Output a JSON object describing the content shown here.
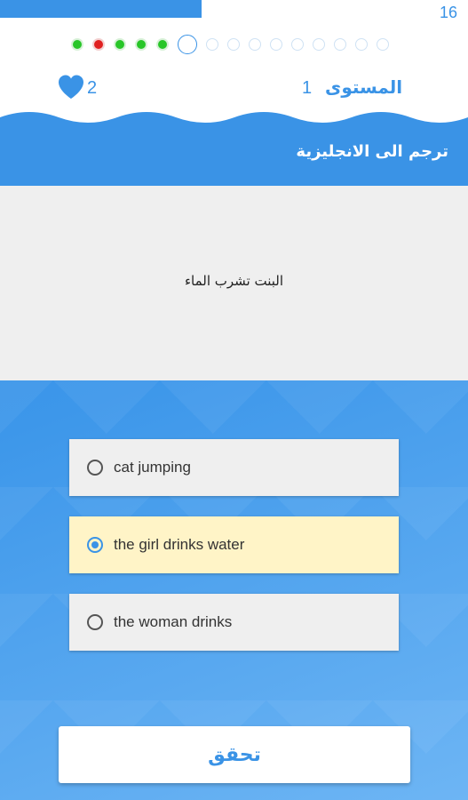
{
  "header": {
    "counter": "16",
    "progress_fraction": 0.43,
    "progress_dots": [
      "correct",
      "wrong",
      "correct",
      "correct",
      "correct",
      "current",
      "pending",
      "pending",
      "pending",
      "pending",
      "pending",
      "pending",
      "pending",
      "pending",
      "pending"
    ],
    "lives": "2",
    "level_label": "المستوى",
    "level_number": "1",
    "heart_icon": "heart-icon"
  },
  "instruction": "ترجم الى الانجليزية",
  "question": {
    "text": "البنت تشرب الماء"
  },
  "options": [
    {
      "label": "cat jumping",
      "selected": false
    },
    {
      "label": "the girl drinks water",
      "selected": true
    },
    {
      "label": "the woman drinks",
      "selected": false
    }
  ],
  "check_button": {
    "label": "تحقق"
  },
  "colors": {
    "accent": "#3a93e6",
    "selected_option": "#fff4c7",
    "correct": "#28c628",
    "wrong": "#e02020"
  }
}
